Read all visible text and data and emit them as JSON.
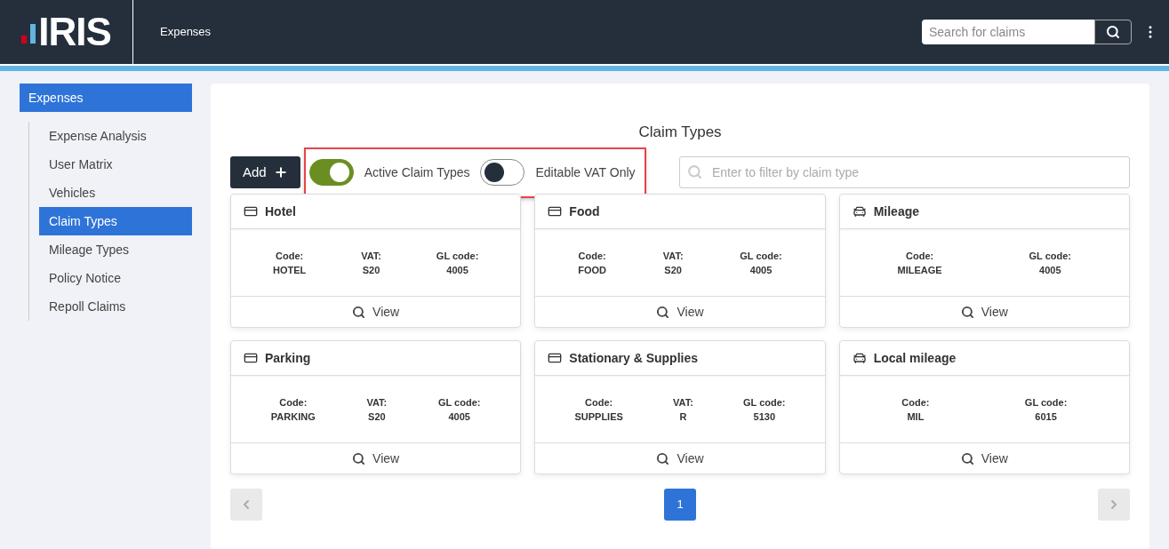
{
  "header": {
    "logo": "IRIS",
    "app_title": "Expenses",
    "search": {
      "placeholder": "Search for claims"
    }
  },
  "sidebar": {
    "heading": "Expenses",
    "items": [
      {
        "label": "Expense Analysis",
        "selected": false
      },
      {
        "label": "User Matrix",
        "selected": false
      },
      {
        "label": "Vehicles",
        "selected": false
      },
      {
        "label": "Claim Types",
        "selected": true
      },
      {
        "label": "Mileage Types",
        "selected": false
      },
      {
        "label": "Policy Notice",
        "selected": false
      },
      {
        "label": "Repoll Claims",
        "selected": false
      }
    ]
  },
  "page": {
    "title": "Claim Types",
    "add_button": "Add",
    "toggles": [
      {
        "label": "Active Claim Types",
        "on": true
      },
      {
        "label": "Editable VAT Only",
        "on": false
      }
    ],
    "filter": {
      "placeholder": "Enter to filter by claim type"
    }
  },
  "cards": [
    {
      "kind": "card",
      "title": "Hotel",
      "fields": [
        {
          "label": "Code:",
          "value": "HOTEL"
        },
        {
          "label": "VAT:",
          "value": "S20"
        },
        {
          "label": "GL code:",
          "value": "4005"
        }
      ],
      "action": "View"
    },
    {
      "kind": "card",
      "title": "Food",
      "fields": [
        {
          "label": "Code:",
          "value": "FOOD"
        },
        {
          "label": "VAT:",
          "value": "S20"
        },
        {
          "label": "GL code:",
          "value": "4005"
        }
      ],
      "action": "View"
    },
    {
      "kind": "car",
      "title": "Mileage",
      "fields": [
        {
          "label": "Code:",
          "value": "MILEAGE"
        },
        {
          "label": "GL code:",
          "value": "4005"
        }
      ],
      "action": "View"
    },
    {
      "kind": "card",
      "title": "Parking",
      "fields": [
        {
          "label": "Code:",
          "value": "PARKING"
        },
        {
          "label": "VAT:",
          "value": "S20"
        },
        {
          "label": "GL code:",
          "value": "4005"
        }
      ],
      "action": "View"
    },
    {
      "kind": "card",
      "title": "Stationary & Supplies",
      "fields": [
        {
          "label": "Code:",
          "value": "SUPPLIES"
        },
        {
          "label": "VAT:",
          "value": "R"
        },
        {
          "label": "GL code:",
          "value": "5130"
        }
      ],
      "action": "View"
    },
    {
      "kind": "car",
      "title": "Local mileage",
      "fields": [
        {
          "label": "Code:",
          "value": "MIL"
        },
        {
          "label": "GL code:",
          "value": "6015"
        }
      ],
      "action": "View"
    }
  ],
  "pagination": {
    "pages": [
      {
        "label": "1",
        "selected": true
      }
    ]
  }
}
